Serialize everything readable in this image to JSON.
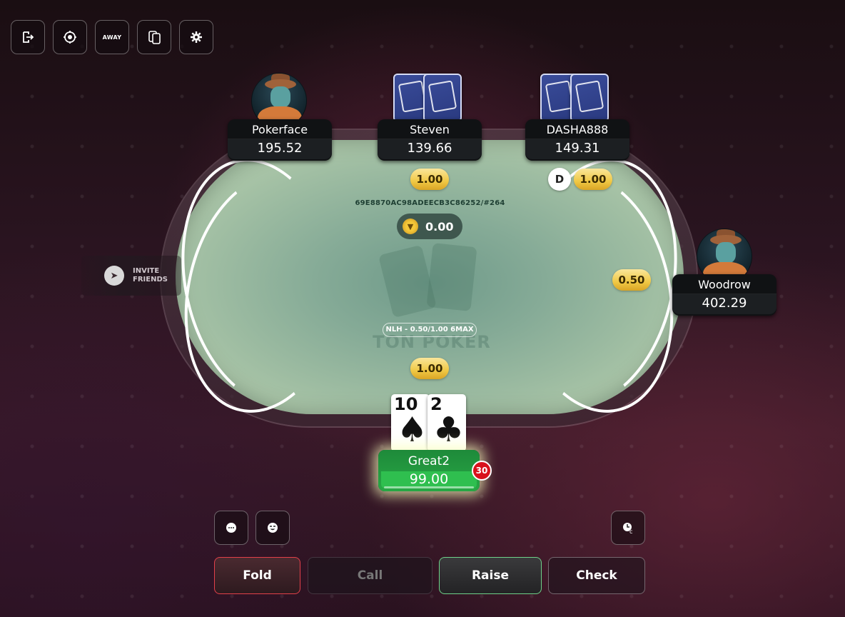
{
  "toolbar": {
    "exit_icon": "exit-icon",
    "rebuy_icon": "chip-icon",
    "away_label": "AWAY",
    "cards_icon": "cards-icon",
    "settings_icon": "gear-icon"
  },
  "table": {
    "hand_id": "69E8870AC98ADEECB3C86252/#264",
    "pot": "0.00",
    "game_info": "NLH - 0.50/1.00 6MAX",
    "watermark": "TON POKER"
  },
  "players": {
    "pokerface": {
      "name": "Pokerface",
      "stack": "195.52"
    },
    "steven": {
      "name": "Steven",
      "stack": "139.66",
      "bet": "1.00"
    },
    "dasha": {
      "name": "DASHA888",
      "stack": "149.31",
      "bet": "1.00",
      "dealer": "D"
    },
    "woodrow": {
      "name": "Woodrow",
      "stack": "402.29",
      "bet": "0.50"
    },
    "hero": {
      "name": "Great2",
      "stack": "99.00",
      "bet": "1.00",
      "timer": "30",
      "cards": [
        {
          "rank": "10",
          "suit": "♠"
        },
        {
          "rank": "2",
          "suit": "♣"
        }
      ]
    }
  },
  "invite": {
    "line1": "INVITE",
    "line2": "FRIENDS"
  },
  "actions": {
    "fold": "Fold",
    "call": "Call",
    "raise": "Raise",
    "check": "Check"
  },
  "colors": {
    "fold_border": "#e2404a",
    "raise_border": "#6fd28a",
    "hero_green": "#28a745",
    "bet_gold": "#f0c845"
  }
}
